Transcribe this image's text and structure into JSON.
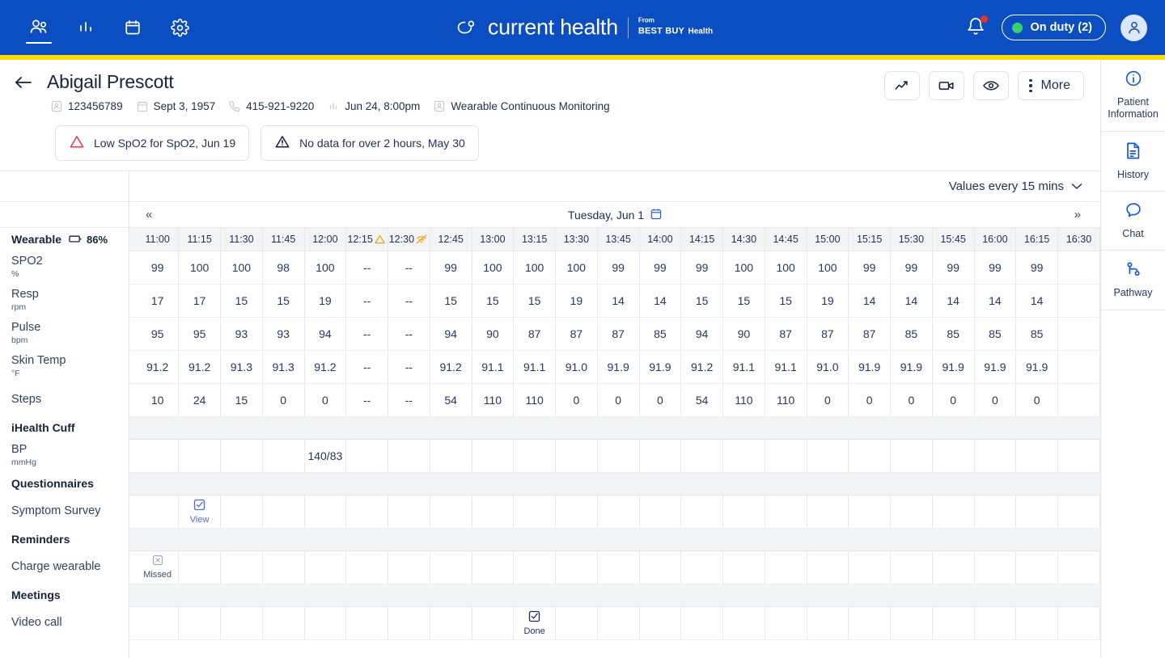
{
  "topnav": {
    "icons": [
      {
        "name": "patients-icon",
        "active": true
      },
      {
        "name": "analytics-icon",
        "active": false
      },
      {
        "name": "calendar-icon",
        "active": false
      },
      {
        "name": "settings-gear-icon",
        "active": false
      }
    ],
    "brand_name": "current health",
    "brand_from": "From",
    "brand_bestbuy": "BEST BUY",
    "brand_health": "Health",
    "on_duty_label": "On duty (2)",
    "accent_blue": "#0b4ec2",
    "accent_yellow": "#fddb00",
    "status_green": "#38d16a",
    "badge_red": "#e3342f"
  },
  "patient": {
    "name": "Abigail Prescott",
    "meta": [
      {
        "icon": "person-icon",
        "text": "123456789"
      },
      {
        "icon": "calendar-icon",
        "text": "Sept 3, 1957"
      },
      {
        "icon": "phone-icon",
        "text": "415-921-9220"
      },
      {
        "icon": "chart-icon",
        "text": "Jun 24, 8:00pm"
      },
      {
        "icon": "person-icon",
        "text": "Wearable Continuous Monitoring"
      }
    ],
    "alerts": [
      {
        "icon": "alert-triangle-red-icon",
        "text": "Low SpO2 for SpO2, Jun 19",
        "color": "#e8384f"
      },
      {
        "icon": "alert-triangle-navy-icon",
        "text": "No data for over 2 hours, May 30",
        "color": "#17223b"
      }
    ],
    "actions": [
      {
        "name": "trend-icon",
        "label": ""
      },
      {
        "name": "video-camera-icon",
        "label": ""
      },
      {
        "name": "eye-icon",
        "label": ""
      }
    ],
    "more_label": "More"
  },
  "rail": [
    {
      "icon": "info-circle-icon",
      "label": "Patient Information"
    },
    {
      "icon": "document-icon",
      "label": "History"
    },
    {
      "icon": "chat-bubble-icon",
      "label": "Chat"
    },
    {
      "icon": "pathway-icon",
      "label": "Pathway"
    }
  ],
  "toolbar": {
    "interval_label": "Values every 15 mins",
    "prev_label": "«",
    "next_label": "»",
    "date_label": "Tuesday, Jun 1"
  },
  "grid": {
    "times": [
      "11:00",
      "11:15",
      "11:30",
      "11:45",
      "12:00",
      "12:15",
      "12:30",
      "12:45",
      "13:00",
      "13:15",
      "13:30",
      "13:45",
      "14:00",
      "14:15",
      "14:30",
      "14:45",
      "15:00",
      "15:15",
      "15:30",
      "15:45",
      "16:00",
      "16:15",
      "16:30"
    ],
    "time_flags": {
      "12:15": "warning-triangle-icon",
      "12:30": "no-signal-icon"
    },
    "highlight_columns": [
      "12:15",
      "12:30"
    ],
    "highlight_color": "#f0a827"
  },
  "sections": [
    {
      "title": "Wearable",
      "battery": "86%",
      "battery_icon": "battery-icon",
      "rows": [
        {
          "name": "SPO2",
          "unit": "%",
          "values": [
            "99",
            "100",
            "100",
            "98",
            "100",
            "--",
            "--",
            "99",
            "100",
            "100",
            "100",
            "99",
            "99",
            "99",
            "100",
            "100",
            "100",
            "99",
            "99",
            "99",
            "99",
            "99"
          ]
        },
        {
          "name": "Resp",
          "unit": "rpm",
          "values": [
            "17",
            "17",
            "15",
            "15",
            "19",
            "--",
            "--",
            "15",
            "15",
            "15",
            "19",
            "14",
            "14",
            "15",
            "15",
            "15",
            "19",
            "14",
            "14",
            "14",
            "14",
            "14"
          ]
        },
        {
          "name": "Pulse",
          "unit": "bpm",
          "values": [
            "95",
            "95",
            "93",
            "93",
            "94",
            "--",
            "--",
            "94",
            "90",
            "87",
            "87",
            "87",
            "85",
            "94",
            "90",
            "87",
            "87",
            "87",
            "85",
            "85",
            "85",
            "85"
          ]
        },
        {
          "name": "Skin Temp",
          "unit": "°F",
          "values": [
            "91.2",
            "91.2",
            "91.3",
            "91.3",
            "91.2",
            "--",
            "--",
            "91.2",
            "91.1",
            "91.1",
            "91.0",
            "91.9",
            "91.9",
            "91.2",
            "91.1",
            "91.1",
            "91.0",
            "91.9",
            "91.9",
            "91.9",
            "91.9",
            "91.9"
          ]
        },
        {
          "name": "Steps",
          "unit": "",
          "values": [
            "10",
            "24",
            "15",
            "0",
            "0",
            "--",
            "--",
            "54",
            "110",
            "110",
            "0",
            "0",
            "0",
            "54",
            "110",
            "110",
            "0",
            "0",
            "0",
            "0",
            "0",
            "0"
          ]
        }
      ]
    },
    {
      "title": "iHealth Cuff",
      "rows": [
        {
          "name": "BP",
          "unit": "mmHg",
          "cells": [
            {
              "col": 4,
              "text": "140/83"
            }
          ]
        }
      ]
    },
    {
      "title": "Questionnaires",
      "rows": [
        {
          "name": "Symptom Survey",
          "unit": "",
          "cells": [
            {
              "col": 1,
              "icon": "checkbox-checked-icon",
              "label": "View",
              "style": "view"
            }
          ]
        }
      ]
    },
    {
      "title": "Reminders",
      "rows": [
        {
          "name": "Charge wearable",
          "unit": "",
          "cells": [
            {
              "col": 0,
              "icon": "x-box-icon",
              "label": "Missed",
              "style": "missed"
            }
          ]
        }
      ]
    },
    {
      "title": "Meetings",
      "rows": [
        {
          "name": "Video call",
          "unit": "",
          "cells": [
            {
              "col": 9,
              "icon": "checkbox-checked-icon",
              "label": "Done",
              "style": "done"
            }
          ]
        }
      ]
    }
  ]
}
